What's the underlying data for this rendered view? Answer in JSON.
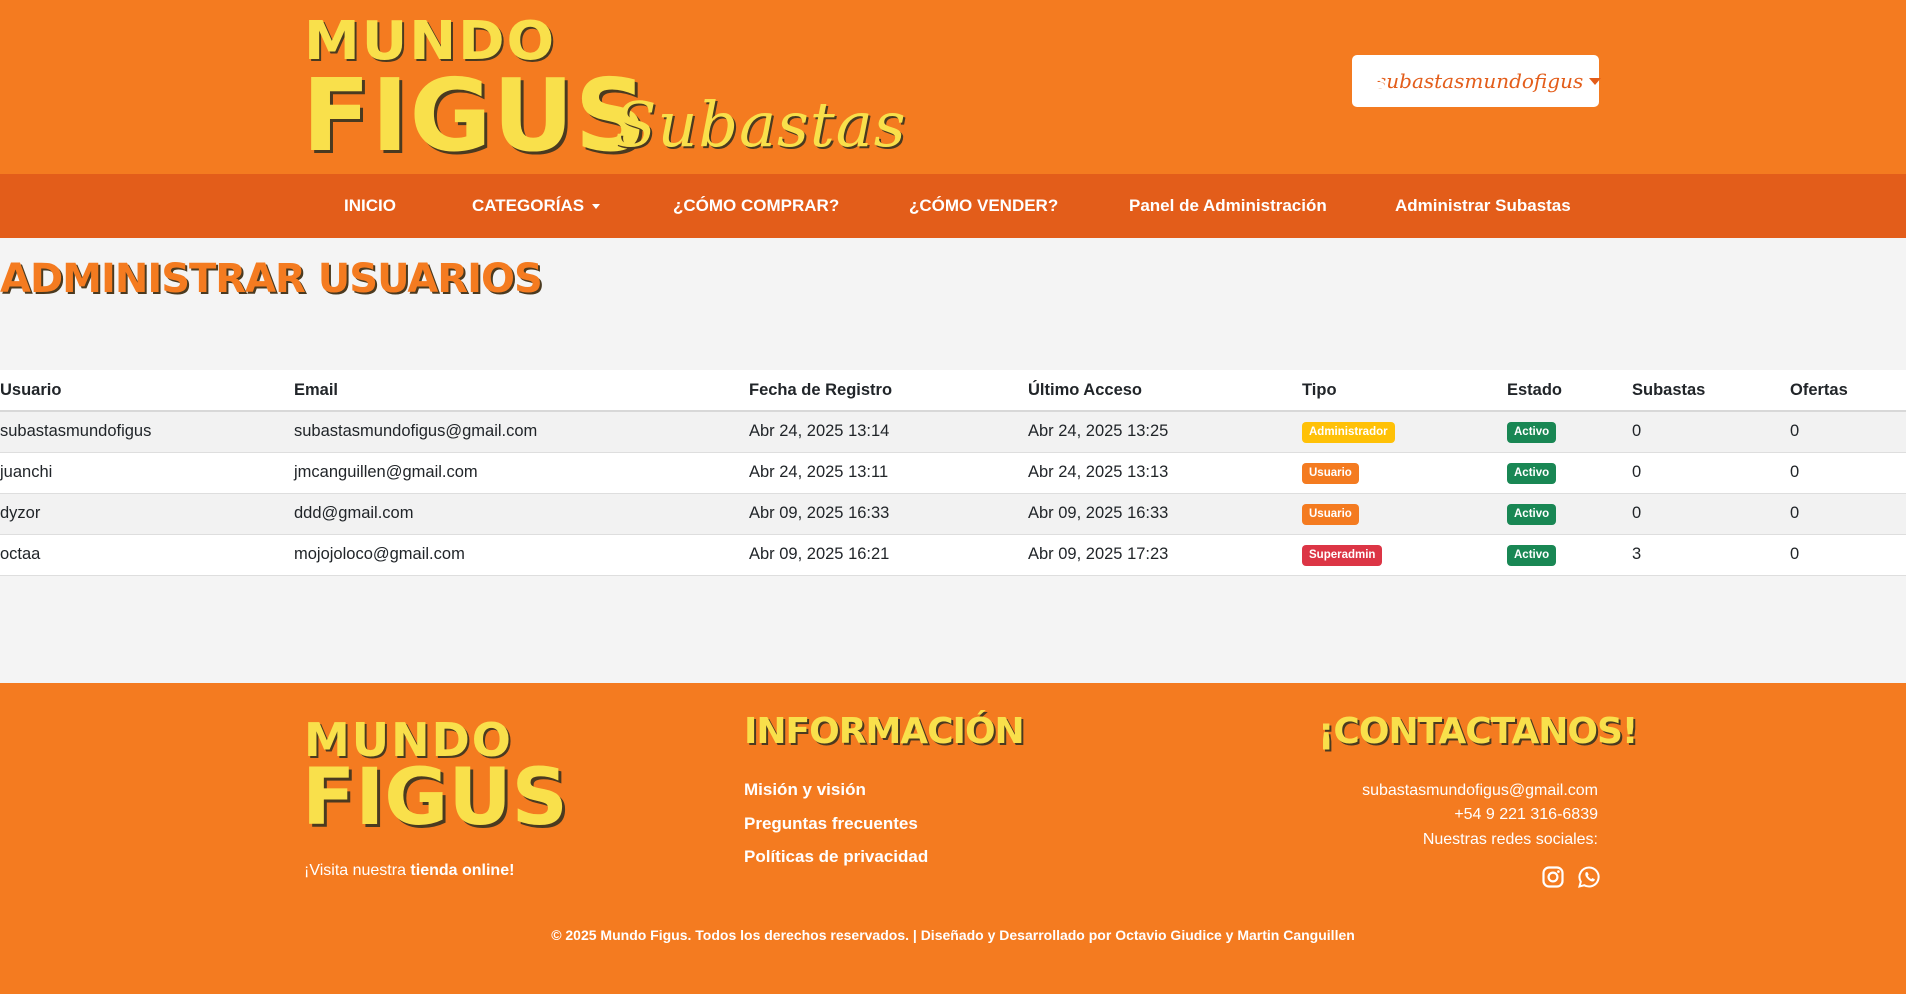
{
  "header": {
    "logo_line1": "MUNDO",
    "logo_line2": "FIGUS",
    "logo_sub": "Subastas",
    "user_icon": "user-circle-icon",
    "username": "subastasmundofigus"
  },
  "nav": {
    "items": [
      {
        "label": "INICIO"
      },
      {
        "label": "CATEGORÍAS"
      },
      {
        "label": "¿CÓMO COMPRAR?"
      },
      {
        "label": "¿CÓMO VENDER?"
      },
      {
        "label": "Panel de Administración"
      },
      {
        "label": "Administrar Subastas"
      }
    ]
  },
  "page": {
    "title": "Administrar Usuarios"
  },
  "table": {
    "headers": [
      "Usuario",
      "Email",
      "Fecha de Registro",
      "Último Acceso",
      "Tipo",
      "Estado",
      "Subastas",
      "Ofertas"
    ],
    "rows": [
      {
        "usuario": "subastasmundofigus",
        "email": "subastasmundofigus@gmail.com",
        "registro": "Abr 24, 2025 13:14",
        "acceso": "Abr 24, 2025 13:25",
        "tipo": "Administrador",
        "estado": "Activo",
        "subastas": "0",
        "ofertas": "0"
      },
      {
        "usuario": "juanchi",
        "email": "jmcanguillen@gmail.com",
        "registro": "Abr 24, 2025 13:11",
        "acceso": "Abr 24, 2025 13:13",
        "tipo": "Usuario",
        "estado": "Activo",
        "subastas": "0",
        "ofertas": "0"
      },
      {
        "usuario": "dyzor",
        "email": "ddd@gmail.com",
        "registro": "Abr 09, 2025 16:33",
        "acceso": "Abr 09, 2025 16:33",
        "tipo": "Usuario",
        "estado": "Activo",
        "subastas": "0",
        "ofertas": "0"
      },
      {
        "usuario": "octaa",
        "email": "mojojoloco@gmail.com",
        "registro": "Abr 09, 2025 16:21",
        "acceso": "Abr 09, 2025 17:23",
        "tipo": "Superadmin",
        "estado": "Activo",
        "subastas": "3",
        "ofertas": "0"
      }
    ]
  },
  "footer": {
    "logo_line1": "MUNDO",
    "logo_line2": "FIGUS",
    "visit_prefix": "¡Visita nuestra ",
    "visit_link": "tienda online!",
    "info_heading": "Información",
    "info_links": [
      "Misión y visión",
      "Preguntas frecuentes",
      "Políticas de privacidad"
    ],
    "contact_heading": "¡Contactanos!",
    "email": "subastasmundofigus@gmail.com",
    "phone": "+54 9 221 316-6839",
    "social_label": "Nuestras redes sociales:",
    "social_icons": [
      "instagram-icon",
      "whatsapp-icon"
    ],
    "copyright": "© 2025 Mundo Figus. Todos los derechos reservados. | Diseñado y Desarrollado por Octavio Giudice y Martin Canguillen"
  },
  "colors": {
    "header_bg": "#f47b20",
    "nav_bg": "#e35d1a",
    "logo_yellow": "#f9e04b",
    "badge_admin": "#ffc107",
    "badge_user": "#f47b20",
    "badge_superadmin": "#dc3545",
    "badge_active": "#198754"
  }
}
